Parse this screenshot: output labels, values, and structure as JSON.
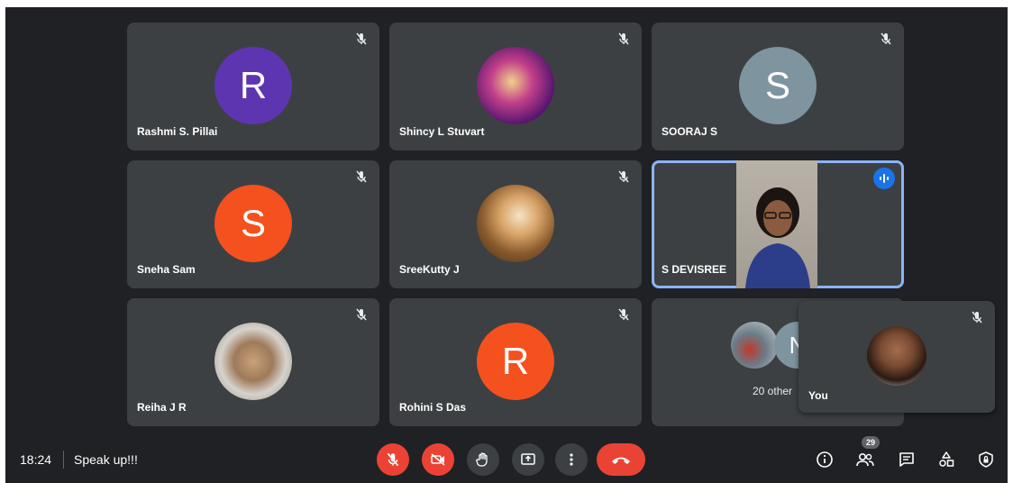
{
  "participants": [
    {
      "name": "Rashmi S. Pillai",
      "initial": "R",
      "avatar_color": "#5e35b1"
    },
    {
      "name": "Shincy L Stuvart",
      "initial": "",
      "avatar_color": ""
    },
    {
      "name": "SOORAJ S",
      "initial": "S",
      "avatar_color": "#7e959f"
    },
    {
      "name": "Sneha Sam",
      "initial": "S",
      "avatar_color": "#f4511e"
    },
    {
      "name": "SreeKutty J",
      "initial": "",
      "avatar_color": ""
    },
    {
      "name": "S DEVISREE",
      "initial": "",
      "avatar_color": ""
    },
    {
      "name": "Reiha J R",
      "initial": "",
      "avatar_color": ""
    },
    {
      "name": "Rohini S Das",
      "initial": "R",
      "avatar_color": "#f4511e"
    }
  ],
  "others_tile": {
    "label": "20 other",
    "partial_initial": "N"
  },
  "self_view": {
    "name": "You"
  },
  "bottom_bar": {
    "time": "18:24",
    "meeting_title": "Speak up!!!",
    "participant_count": "29"
  },
  "colors": {
    "background": "#202124",
    "tile": "#3c4043",
    "active_border": "#8ab4f8",
    "danger": "#ea4335",
    "speaking_badge": "#1a73e8"
  }
}
